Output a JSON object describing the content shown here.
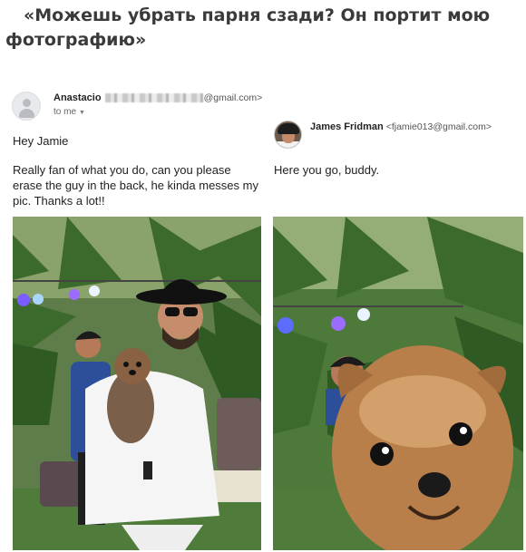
{
  "headline": {
    "line1": "«Можешь убрать парня сзади? Он портит мою",
    "line2": "фотографию»"
  },
  "left_email": {
    "sender_name": "Anastacio",
    "sender_email_suffix": "@gmail.com>",
    "recipient": "to me",
    "greeting": "Hey Jamie",
    "message": "Really fan of what you do, can you please erase the guy in the back, he kinda messes my pic. Thanks a lot!!"
  },
  "right_email": {
    "sender_name": "James Fridman",
    "sender_email": "<fjamie013@gmail.com>",
    "reply": "Here you go, buddy."
  },
  "colors": {
    "headline": "#3a3a3a",
    "body_text": "#222222",
    "foliage": "#3f6b2f",
    "dog_fur": "#b87f4a"
  }
}
